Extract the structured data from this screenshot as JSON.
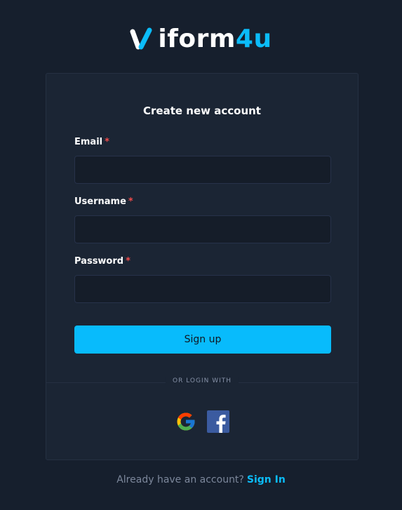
{
  "brand": {
    "name_part_a": "iform",
    "name_part_b": "4u",
    "accent_color": "#0bbcf9"
  },
  "form": {
    "title": "Create new account",
    "fields": [
      {
        "label": "Email",
        "required_mark": "*",
        "value": "",
        "placeholder": ""
      },
      {
        "label": "Username",
        "required_mark": "*",
        "value": "",
        "placeholder": ""
      },
      {
        "label": "Password",
        "required_mark": "*",
        "value": "",
        "placeholder": ""
      }
    ],
    "submit_label": "Sign up"
  },
  "social": {
    "divider_text": "OR LOGIN WITH",
    "providers": [
      {
        "name": "Google",
        "icon": "google-icon"
      },
      {
        "name": "Facebook",
        "icon": "facebook-icon"
      }
    ]
  },
  "footer": {
    "prompt": "Already have an account?",
    "link_label": "Sign In"
  }
}
